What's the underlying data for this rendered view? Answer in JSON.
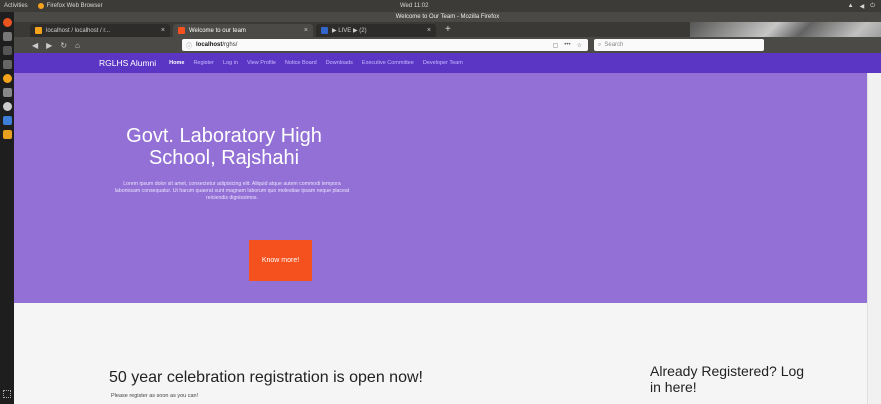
{
  "os": {
    "activities": "Activities",
    "app_name": "Firefox Web Browser",
    "clock": "Wed 11:02",
    "tray": [
      "▲",
      "◀",
      "⏻"
    ]
  },
  "browser": {
    "window_title": "Welcome to Our Team - Mozilla Firefox",
    "tabs": [
      {
        "label": "localhost / localhost / r...",
        "color": "#f4a31b"
      },
      {
        "label": "Welcome to our team",
        "color": "#f4511e"
      },
      {
        "label": "▶ LIVE ▶ (2)",
        "color": "#3366cc"
      }
    ],
    "new_tab": "+",
    "url_info": "ⓘ",
    "url_host": "localhost",
    "url_path": "/rghs/",
    "url_actions": [
      "▢",
      "•••",
      "☆"
    ],
    "search_placeholder": "Search"
  },
  "site": {
    "brand": "RGLHS Alumni",
    "nav": [
      "Home",
      "Register",
      "Log in",
      "View Profile",
      "Notice Board",
      "Downloads",
      "Executive Committee",
      "Developer Team"
    ],
    "hero_title": "Govt. Laboratory High School, Rajshahi",
    "hero_text": "Lorem ipsum dolor sit amet, consectetur adipisicing elit. Aliquid atque autem commodi tempora laboriosam consequatur. Ut harum quaerat sunt magnam laborum quo molestiae ipsam neque placeat reiciendis dignissimos.",
    "cta": "Know more!",
    "announcement": "50 year celebration registration is open now!",
    "announcement_sub": "Please register as soon as you can!",
    "login_prompt": "Already Registered? Log in here!"
  }
}
